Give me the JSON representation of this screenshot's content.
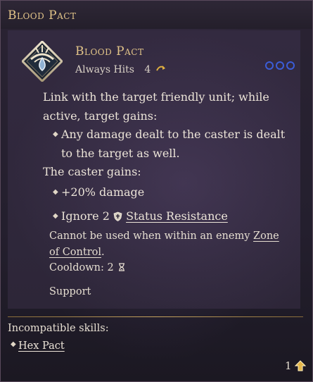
{
  "header": {
    "title": "Blood Pact"
  },
  "ability": {
    "name": "Blood Pact",
    "accuracy": "Always Hits",
    "cost": "4",
    "cost_icon": "curved-arrow-icon",
    "slots_icon": "three-rings-icon",
    "emblem_icon": "blood-drop-eye-icon"
  },
  "description": {
    "intro": "Link with the target friendly unit; while active, target gains:",
    "target_bullet": "Any damage dealt to the caster is dealt to the target as well.",
    "caster_intro": "The caster gains:",
    "caster_bullet_1": "+20% damage",
    "caster_bullet_2_prefix": "Ignore 2",
    "caster_bullet_2_link": "Status Resistance"
  },
  "notes": {
    "zoc_prefix": "Cannot be used when within an enemy ",
    "zoc_link": "Zone of Control",
    "zoc_suffix": ".",
    "cooldown": "Cooldown: 2",
    "category": "Support"
  },
  "incompatible": {
    "title": "Incompatible skills:",
    "items": [
      "Hex Pact"
    ]
  },
  "footer": {
    "page": "1"
  },
  "colors": {
    "title_gold": "#e2c489",
    "slot_blue": "#3b5dd8",
    "divider_gold": "#c7a45f"
  }
}
